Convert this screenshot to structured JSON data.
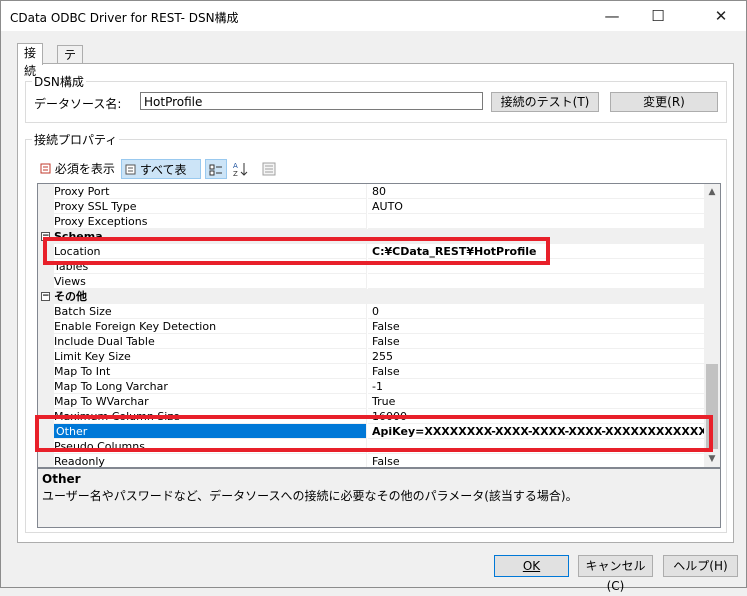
{
  "window": {
    "title": "CData ODBC Driver for REST- DSN構成",
    "minimize": "—",
    "maximize": "☐",
    "close": "✕"
  },
  "tabs": [
    {
      "label": "接続",
      "active": true
    },
    {
      "label": "テーブル",
      "active": false
    }
  ],
  "dsn": {
    "group_label": "DSN構成",
    "datasource_label": "データソース名:",
    "datasource_value": "HotProfile",
    "test_button": "接続のテスト(T)",
    "change_button": "変更(R)"
  },
  "props": {
    "group_label": "接続プロパティ",
    "toolbar": {
      "required_label": "必須を表示",
      "all_label": "すべて表示"
    },
    "rows": [
      {
        "type": "prop",
        "name": "Proxy Port",
        "value": "80"
      },
      {
        "type": "prop",
        "name": "Proxy SSL Type",
        "value": "AUTO"
      },
      {
        "type": "prop",
        "name": "Proxy Exceptions",
        "value": ""
      },
      {
        "type": "cat",
        "name": "Schema",
        "value": ""
      },
      {
        "type": "prop",
        "name": "Location",
        "value": "C:¥CData_REST¥HotProfile",
        "bold": true
      },
      {
        "type": "prop",
        "name": "Tables",
        "value": ""
      },
      {
        "type": "prop",
        "name": "Views",
        "value": ""
      },
      {
        "type": "cat",
        "name": "その他",
        "value": ""
      },
      {
        "type": "prop",
        "name": "Batch Size",
        "value": "0"
      },
      {
        "type": "prop",
        "name": "Enable Foreign Key Detection",
        "value": "False"
      },
      {
        "type": "prop",
        "name": "Include Dual Table",
        "value": "False"
      },
      {
        "type": "prop",
        "name": "Limit Key Size",
        "value": "255"
      },
      {
        "type": "prop",
        "name": "Map To Int",
        "value": "False"
      },
      {
        "type": "prop",
        "name": "Map To Long Varchar",
        "value": "-1"
      },
      {
        "type": "prop",
        "name": "Map To WVarchar",
        "value": "True"
      },
      {
        "type": "prop",
        "name": "Maximum Column Size",
        "value": "16000"
      },
      {
        "type": "sel",
        "name": "Other",
        "value": "ApiKey=XXXXXXXX-XXXX-XXXX-XXXX-XXXXXXXXXXXX"
      },
      {
        "type": "prop",
        "name": "Pseudo Columns",
        "value": ""
      },
      {
        "type": "prop",
        "name": "Readonly",
        "value": "False"
      }
    ]
  },
  "description": {
    "title": "Other",
    "text": "ユーザー名やパスワードなど、データソースへの接続に必要なその他のパラメータ(該当する場合)。"
  },
  "footer": {
    "ok": "OK",
    "cancel": "キャンセル(C)",
    "help": "ヘルプ(H)"
  },
  "colors": {
    "highlight_red": "#e8202a",
    "selection_blue": "#0078d7"
  }
}
